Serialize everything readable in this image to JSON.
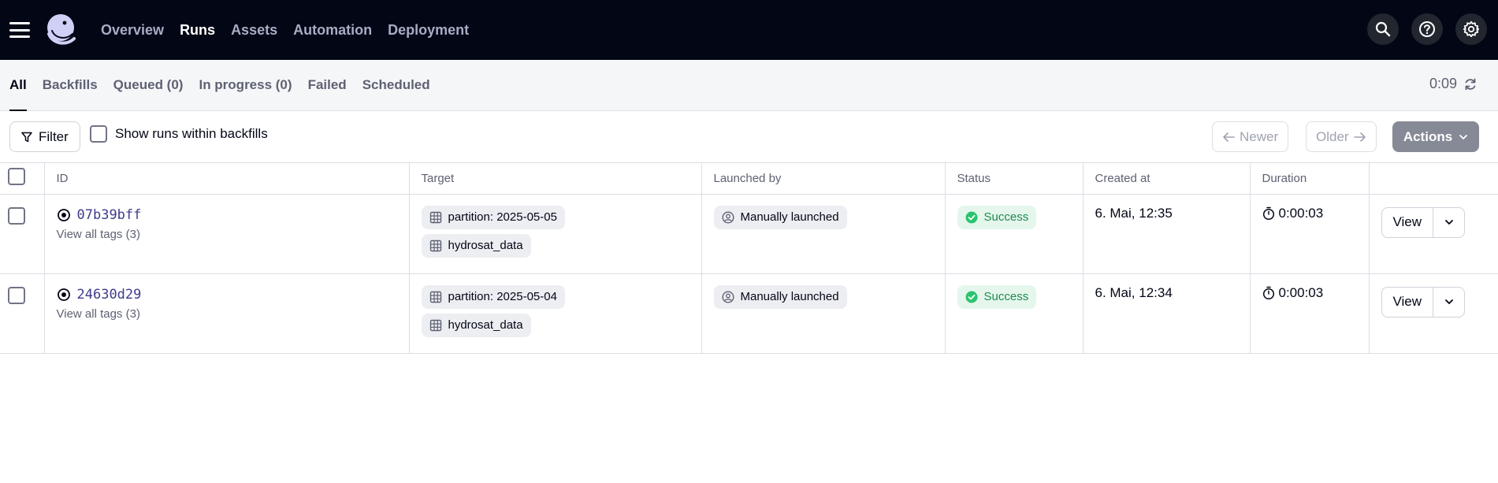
{
  "nav": {
    "links": [
      "Overview",
      "Runs",
      "Assets",
      "Automation",
      "Deployment"
    ],
    "active": "Runs"
  },
  "tabs": [
    "All",
    "Backfills",
    "Queued (0)",
    "In progress (0)",
    "Failed",
    "Scheduled"
  ],
  "refresh": {
    "countdown": "0:09"
  },
  "toolbar": {
    "filter_label": "Filter",
    "show_backfills_label": "Show runs within backfills",
    "newer_label": "Newer",
    "older_label": "Older",
    "actions_label": "Actions"
  },
  "table": {
    "headers": {
      "id": "ID",
      "target": "Target",
      "launched_by": "Launched by",
      "status": "Status",
      "created_at": "Created at",
      "duration": "Duration"
    },
    "rows": [
      {
        "id": "07b39bff",
        "tags_link": "View all tags (3)",
        "partition": "partition: 2025-05-05",
        "asset": "hydrosat_data",
        "launched_by": "Manually launched",
        "status": "Success",
        "created_at": "6. Mai, 12:35",
        "duration": "0:00:03",
        "view_label": "View"
      },
      {
        "id": "24630d29",
        "tags_link": "View all tags (3)",
        "partition": "partition: 2025-05-04",
        "asset": "hydrosat_data",
        "launched_by": "Manually launched",
        "status": "Success",
        "created_at": "6. Mai, 12:34",
        "duration": "0:00:03",
        "view_label": "View"
      }
    ]
  },
  "colors": {
    "nav_bg": "#030615",
    "success_bg": "#e5f7ed",
    "success_fg": "#1e8a4f",
    "link": "#3e3b8c",
    "actions_bg": "#868996"
  }
}
